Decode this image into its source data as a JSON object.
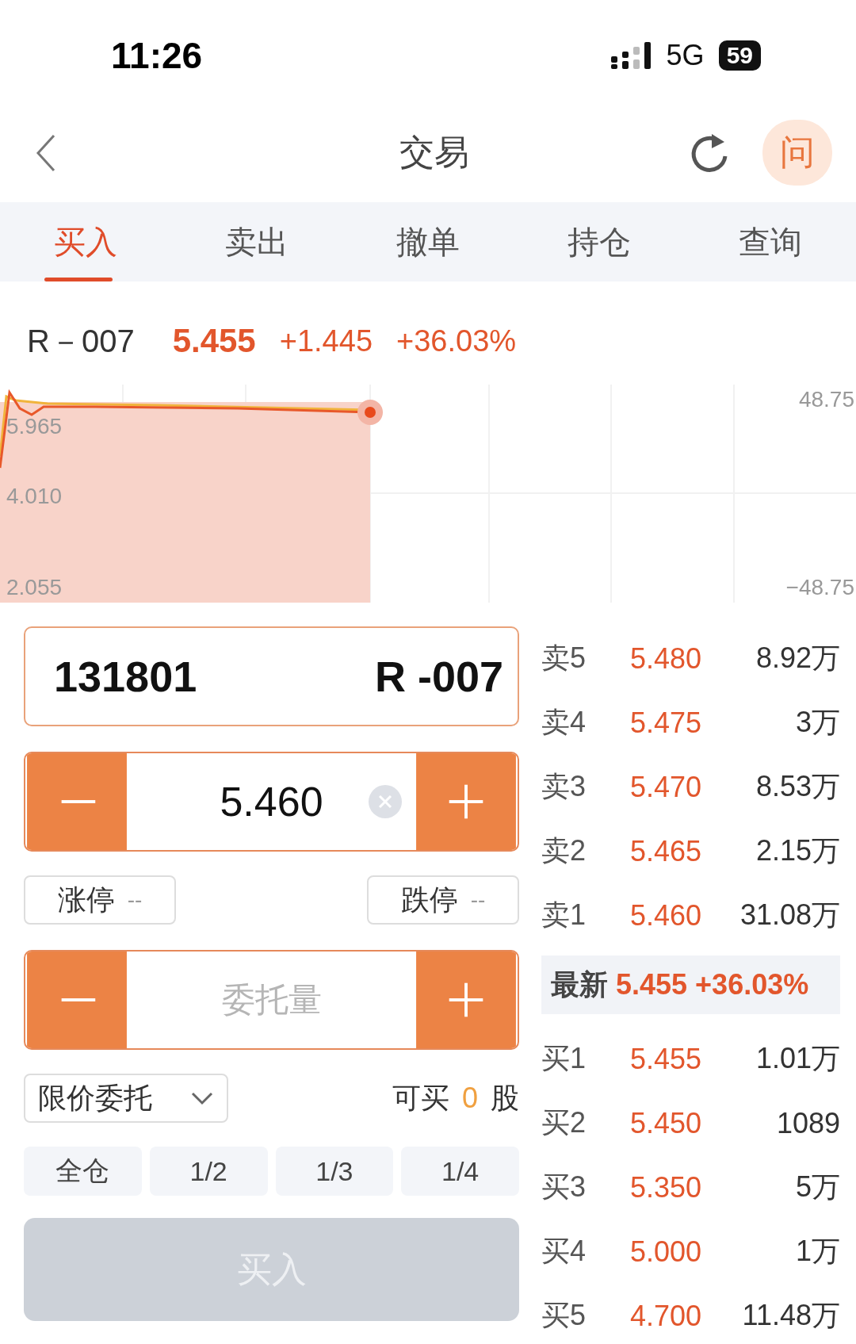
{
  "status_bar": {
    "time": "11:26",
    "network": "5G",
    "battery": "59"
  },
  "header": {
    "title": "交易",
    "help": "问"
  },
  "tabs": [
    {
      "label": "买入",
      "selected": true
    },
    {
      "label": "卖出",
      "selected": false
    },
    {
      "label": "撤单",
      "selected": false
    },
    {
      "label": "持仓",
      "selected": false
    },
    {
      "label": "查询",
      "selected": false
    }
  ],
  "quote": {
    "name": "R－007",
    "price": "5.455",
    "change": "+1.445",
    "percent": "+36.03%"
  },
  "chart": {
    "left_labels": [
      "5.965",
      "4.010",
      "2.055"
    ],
    "right_labels": [
      "48.75",
      "−48.75"
    ]
  },
  "order_form": {
    "code": "131801",
    "name": "R -007",
    "price": "5.460",
    "quantity_placeholder": "委托量",
    "limits": [
      {
        "label": "涨停",
        "value": "--"
      },
      {
        "label": "跌停",
        "value": "--"
      }
    ],
    "order_type": "限价委托",
    "available_label": "可买",
    "available": "0",
    "unit": "股",
    "fractions": [
      "全仓",
      "1/2",
      "1/3",
      "1/4"
    ],
    "submit": {
      "label": "买入",
      "disabled": true
    }
  },
  "order_book": {
    "asks": [
      {
        "label": "卖5",
        "price": "5.480",
        "volume": "8.92万"
      },
      {
        "label": "卖4",
        "price": "5.475",
        "volume": "3万"
      },
      {
        "label": "卖3",
        "price": "5.470",
        "volume": "8.53万"
      },
      {
        "label": "卖2",
        "price": "5.465",
        "volume": "2.15万"
      },
      {
        "label": "卖1",
        "price": "5.460",
        "volume": "31.08万"
      }
    ],
    "latest": {
      "label": "最新",
      "price": "5.455",
      "percent": "+36.03%"
    },
    "bids": [
      {
        "label": "买1",
        "price": "5.455",
        "volume": "1.01万"
      },
      {
        "label": "买2",
        "price": "5.450",
        "volume": "1089"
      },
      {
        "label": "买3",
        "price": "5.350",
        "volume": "5万"
      },
      {
        "label": "买4",
        "price": "5.000",
        "volume": "1万"
      },
      {
        "label": "买5",
        "price": "4.700",
        "volume": "11.48万"
      }
    ]
  }
}
